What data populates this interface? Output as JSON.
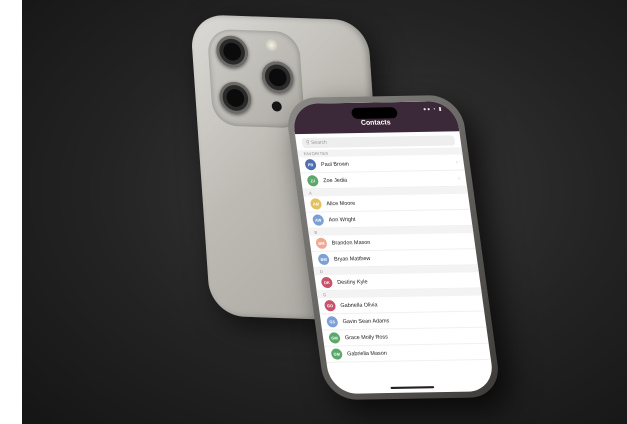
{
  "contacts_app": {
    "title": "Contacts",
    "status_icons": "●● • ▮",
    "search_placeholder": "Search",
    "favorites_header": "FAVORITES",
    "favorites": [
      {
        "initials": "PB",
        "name": "Paul Brown",
        "color": "#4f6fb0"
      },
      {
        "initials": "ZJ",
        "name": "Zoe Jedia",
        "color": "#5aa86a"
      }
    ],
    "sections": [
      {
        "letter": "A",
        "contacts": [
          {
            "initials": "AM",
            "name": "Alice Moore",
            "color": "#e3c15e"
          },
          {
            "initials": "AW",
            "name": "Ann Wright",
            "color": "#7c9fd6"
          }
        ]
      },
      {
        "letter": "B",
        "contacts": [
          {
            "initials": "BM",
            "name": "Brandon Mason",
            "color": "#f0a890"
          },
          {
            "initials": "BM",
            "name": "Bryan Matthew",
            "color": "#7c9fd6"
          }
        ]
      },
      {
        "letter": "D",
        "contacts": [
          {
            "initials": "DK",
            "name": "Destiny Kyle",
            "color": "#c8526b"
          }
        ]
      },
      {
        "letter": "G",
        "contacts": [
          {
            "initials": "GO",
            "name": "Gabriella Olivia",
            "color": "#c8526b"
          },
          {
            "initials": "GS",
            "name": "Gavin Sean Adams",
            "color": "#7c9fd6"
          },
          {
            "initials": "GM",
            "name": "Grace Molly Ross",
            "color": "#5aa86a"
          },
          {
            "initials": "GM",
            "name": "Gabriella Mason",
            "color": "#5aa86a"
          }
        ]
      }
    ],
    "colors": {
      "header": "#3b2838",
      "background": "#232323"
    }
  }
}
